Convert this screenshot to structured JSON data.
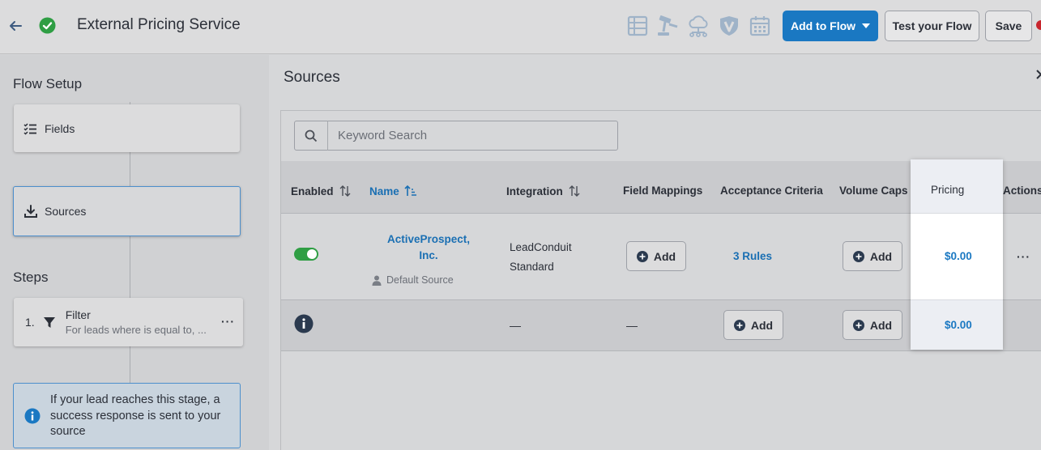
{
  "header": {
    "title": "External Pricing Service",
    "add_to_flow_label": "Add to Flow",
    "test_flow_label": "Test your Flow",
    "save_label": "Save",
    "toolbar_icons": [
      "list-icon",
      "gavel-icon",
      "cloud-network-icon",
      "shield-v-icon",
      "calendar-icon"
    ]
  },
  "sidebar": {
    "flow_setup_heading": "Flow Setup",
    "fields_label": "Fields",
    "sources_label": "Sources",
    "steps_heading": "Steps",
    "step": {
      "number": "1.",
      "title": "Filter",
      "subtitle": "For leads where is equal to, ..."
    },
    "info_message": "If your lead reaches this stage, a success response is sent to your source"
  },
  "main": {
    "title": "Sources",
    "search_placeholder": "Keyword Search",
    "columns": {
      "enabled": "Enabled",
      "name": "Name",
      "integration": "Integration",
      "field_mappings": "Field Mappings",
      "acceptance_criteria": "Acceptance Criteria",
      "volume_caps": "Volume Caps",
      "pricing": "Pricing",
      "actions": "Actions"
    },
    "rows": [
      {
        "name": "ActiveProspect, Inc.",
        "default_source_label": "Default Source",
        "integration_line1": "LeadConduit",
        "integration_line2": "Standard",
        "field_mappings_label": "Add",
        "acceptance_criteria": "3 Rules",
        "volume_caps_label": "Add",
        "pricing": "$0.00",
        "actions": "···"
      },
      {
        "integration": "—",
        "field_mappings": "—",
        "acceptance_criteria_label": "Add",
        "volume_caps_label": "Add",
        "pricing": "$0.00"
      }
    ]
  },
  "colors": {
    "primary": "#1a78c2",
    "link": "#1a6fb3",
    "success": "#2f9e44",
    "record": "#c8262e"
  }
}
